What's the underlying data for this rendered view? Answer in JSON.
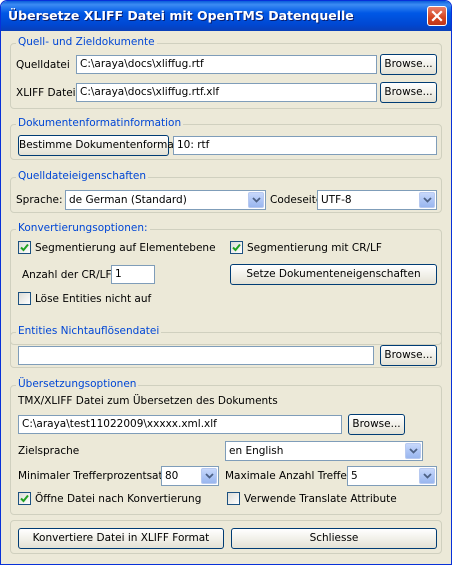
{
  "window": {
    "title": "Übersetze XLIFF Datei mit OpenTMS Datenquelle"
  },
  "source_group": {
    "legend": "Quell- und Zieldokumente",
    "source_label": "Quelldatei",
    "source_value": "C:\\araya\\docs\\xliffug.rtf",
    "xliff_label": "XLIFF Datei",
    "xliff_value": "C:\\araya\\docs\\xliffug.rtf.xlf",
    "browse": "Browse..."
  },
  "format_group": {
    "legend": "Dokumentenformatinformation",
    "detect_button": "Bestimme Dokumentenformat",
    "format_value": "10: rtf"
  },
  "props_group": {
    "legend": "Quelldateieigenschaften",
    "language_label": "Sprache:",
    "language_value": "de German (Standard)",
    "codepage_label": "Codeseite",
    "codepage_value": "UTF-8"
  },
  "conversion_group": {
    "legend": "Konvertierungsoptionen:",
    "segment_element": "Segmentierung auf Elementebene",
    "segment_crlf": "Segmentierung mit CR/LF",
    "crlf_count_label": "Anzahl der CR/LF",
    "crlf_count_value": "1",
    "set_props_button": "Setze Dokumenteneigenschaften",
    "no_resolve_entities": "Löse Entities nicht auf"
  },
  "entities_group": {
    "legend": "Entities Nichtauflösendatei",
    "value": "",
    "browse": "Browse..."
  },
  "translation_group": {
    "legend": "Übersetzungsoptionen",
    "tmx_label": "TMX/XLIFF Datei zum Übersetzen des Dokuments",
    "tmx_value": "C:\\araya\\test11022009\\xxxxx.xml.xlf",
    "browse": "Browse...",
    "target_lang_label": "Zielsprache",
    "target_lang_value": "en English",
    "min_match_label": "Minimaler Trefferprozentsatz",
    "min_match_value": "80",
    "max_hits_label": "Maximale Anzahl Treffer",
    "max_hits_value": "5",
    "open_after": "Öffne Datei nach Konvertierung",
    "use_translate_attr": "Verwende Translate Attribute"
  },
  "checkbox_states": {
    "segment_element": true,
    "segment_crlf": true,
    "no_resolve_entities": false,
    "open_after": true,
    "use_translate_attr": false
  },
  "footer": {
    "convert_button": "Konvertiere Datei in XLIFF Format",
    "close_button": "Schliesse"
  }
}
